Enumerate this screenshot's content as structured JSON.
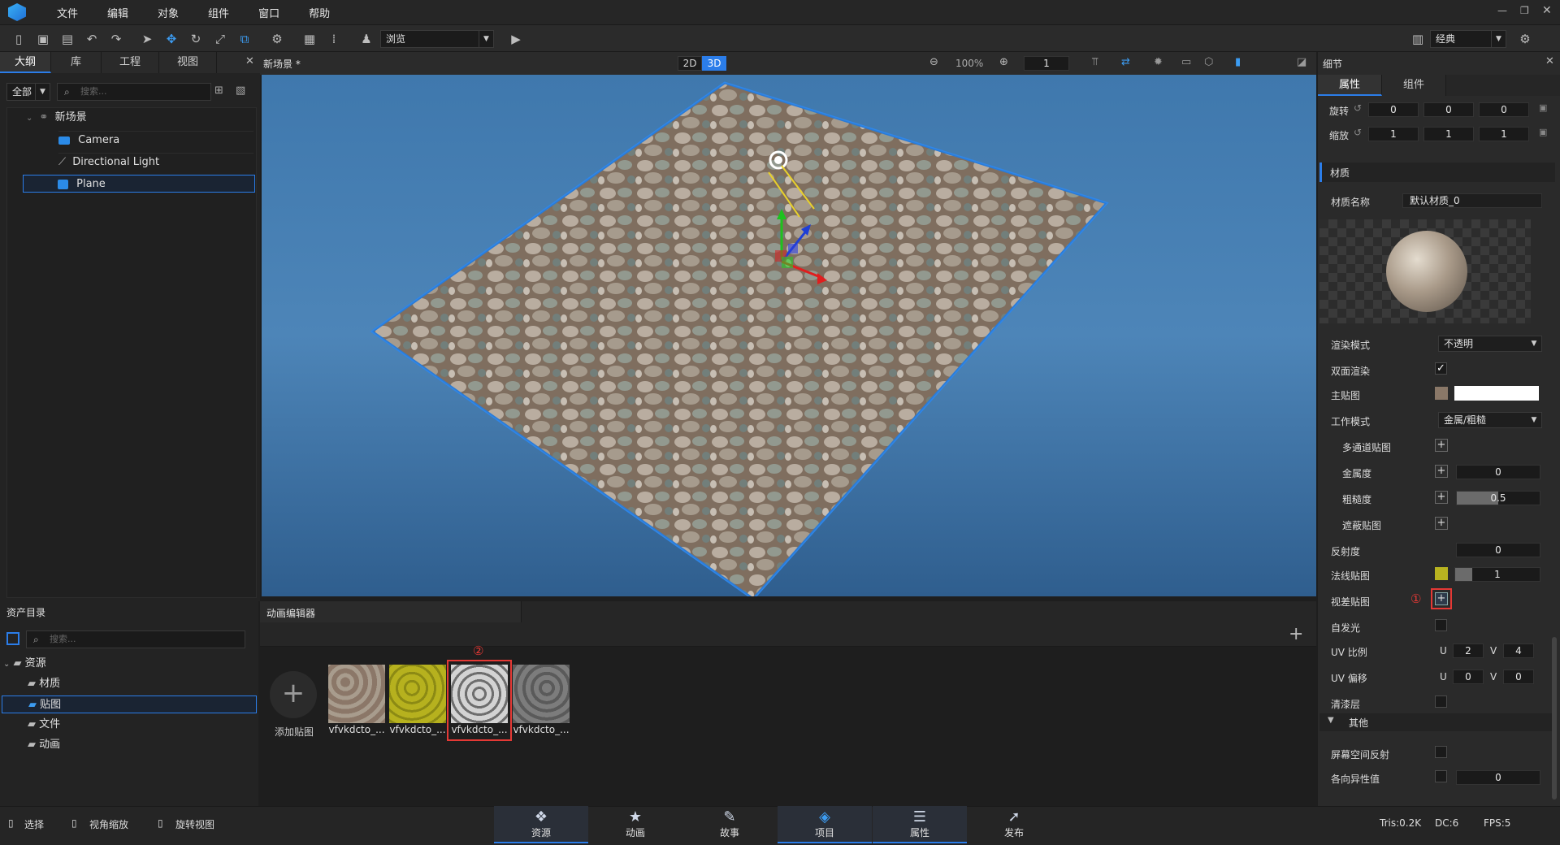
{
  "menu": [
    "文件",
    "编辑",
    "对象",
    "组件",
    "窗口",
    "帮助"
  ],
  "toolbar": {
    "mode_select": "浏览",
    "layout_select": "经典"
  },
  "outline": {
    "tabs": [
      "大纲",
      "库",
      "工程",
      "视图"
    ],
    "filter": "全部",
    "search_placeholder": "搜索...",
    "scene": "新场景",
    "items": [
      "Camera",
      "Directional Light",
      "Plane"
    ]
  },
  "viewport": {
    "title": "新场景 *",
    "mode_2d": "2D",
    "mode_3d": "3D",
    "zoom": "100%",
    "layer": "1"
  },
  "details": {
    "title": "细节",
    "tabs": [
      "属性",
      "组件"
    ],
    "rotation_label": "旋转",
    "rotation": [
      "0",
      "0",
      "0"
    ],
    "scale_label": "缩放",
    "scale": [
      "1",
      "1",
      "1"
    ],
    "material_section": "材质",
    "material_name_label": "材质名称",
    "material_name": "默认材质_0",
    "render_mode_label": "渲染模式",
    "render_mode": "不透明",
    "double_sided_label": "双面渲染",
    "main_map_label": "主贴图",
    "work_mode_label": "工作模式",
    "work_mode": "金属/粗糙",
    "multi_channel_label": "多通道贴图",
    "metalness_label": "金属度",
    "metalness": "0",
    "roughness_label": "粗糙度",
    "roughness": "0.5",
    "occlusion_label": "遮蔽贴图",
    "reflectivity_label": "反射度",
    "reflectivity": "0",
    "normal_label": "法线贴图",
    "normal": "1",
    "parallax_label": "视差贴图",
    "marker1": "①",
    "emissive_label": "自发光",
    "uv_scale_label": "UV 比例",
    "uv_scale_u": "2",
    "uv_scale_v": "4",
    "uv_offset_label": "UV 偏移",
    "uv_offset_u": "0",
    "uv_offset_v": "0",
    "u": "U",
    "v": "V",
    "clearcoat_label": "清漆层",
    "other_section": "其他",
    "ssr_label": "屏幕空间反射",
    "anisotropy_label": "各向异性值",
    "anisotropy": "0"
  },
  "assets": {
    "title": "资产目录",
    "search_placeholder": "搜索...",
    "root": "资源",
    "folders": [
      "材质",
      "贴图",
      "文件",
      "动画"
    ]
  },
  "anim_editor": {
    "title": "动画编辑器",
    "add_label": "添加贴图",
    "marker2": "②",
    "thumbs": [
      "vfvkdcto_...",
      "vfvkdcto_...",
      "vfvkdcto_...",
      "vfvkdcto_..."
    ]
  },
  "bottom_tabs": [
    "资源",
    "动画",
    "故事",
    "项目",
    "属性",
    "发布"
  ],
  "hints": [
    "选择",
    "视角缩放",
    "旋转视图"
  ],
  "stats": {
    "tris": "Tris:0.2K",
    "dc": "DC:6",
    "fps": "FPS:5"
  },
  "colors": {
    "accent": "#2b7de9",
    "highlight": "#e53935"
  }
}
